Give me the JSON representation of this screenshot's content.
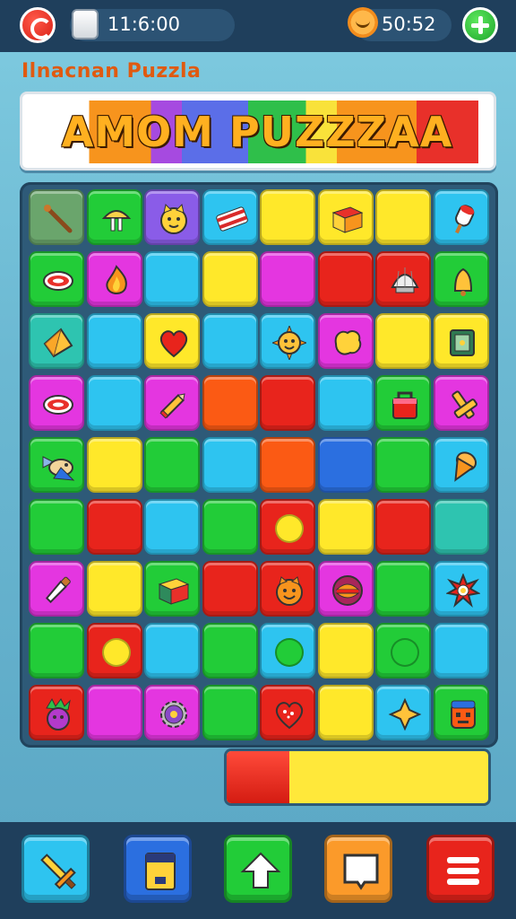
{
  "hud": {
    "timer": "11:6:00",
    "score": "50:52",
    "timer_icon": "timer-card-icon",
    "score_icon": "sun-icon"
  },
  "title": {
    "subtitle": "Ilnacnan Puzzla",
    "main": "AMOM PUZZZAA"
  },
  "palette": {
    "red": "#e8241c",
    "yellow": "#ffe82a",
    "green": "#22cc38",
    "cyan": "#2ec4f0",
    "blue": "#2b6fe0",
    "magenta": "#e436e0",
    "orange": "#fb5a14",
    "teal": "#2ec4b0",
    "darkgreen": "#3c9a44",
    "sage": "#6aa56c",
    "lime": "#22cc38"
  },
  "board": {
    "cols": 8,
    "rows": 10,
    "tiles": [
      [
        "sage:stick",
        "green:mushroom",
        "purple:cat",
        "cyan:bacon",
        "yellow",
        "yellow:box",
        "yellow",
        "cyan:popsicle"
      ],
      [
        "green:meat",
        "magenta:fire",
        "cyan",
        "yellow",
        "magenta",
        "red",
        "red:shell",
        "green:bell"
      ],
      [
        "teal:kite",
        "cyan",
        "yellow:heart",
        "cyan",
        "cyan:sun",
        "magenta:cookie",
        "yellow",
        "yellow:book"
      ],
      [
        "magenta:meat",
        "cyan",
        "magenta:pencil",
        "orange",
        "red",
        "cyan",
        "green:bag",
        "magenta:cross"
      ],
      [
        "green:fish",
        "yellow",
        "green",
        "cyan",
        "orange",
        "blue",
        "green",
        "cyan:icecream"
      ],
      [
        "green",
        "red",
        "cyan",
        "green",
        "red:dot-yellow",
        "yellow",
        "red",
        "teal"
      ],
      [
        "magenta:knife",
        "yellow",
        "green:chest",
        "red",
        "red:face",
        "magenta:burger",
        "green",
        "cyan:splat"
      ],
      [
        "green",
        "red:dot-yellow",
        "cyan",
        "green",
        "cyan:dot-green",
        "yellow",
        "green:dot-green",
        "cyan"
      ],
      [
        "red:beet",
        "magenta",
        "magenta:gear",
        "green",
        "red:heart2",
        "yellow",
        "cyan:star",
        "green:robot"
      ]
    ]
  },
  "progress": {
    "value": 0.24
  },
  "bottom_bar": [
    {
      "name": "sword-icon",
      "color": "#2ec4f0"
    },
    {
      "name": "card-icon",
      "color": "#2b6fe0"
    },
    {
      "name": "arrow-up-icon",
      "color": "#22cc38"
    },
    {
      "name": "frame-icon",
      "color": "#fb9a2a"
    },
    {
      "name": "menu-icon",
      "color": "#e8241c"
    }
  ]
}
